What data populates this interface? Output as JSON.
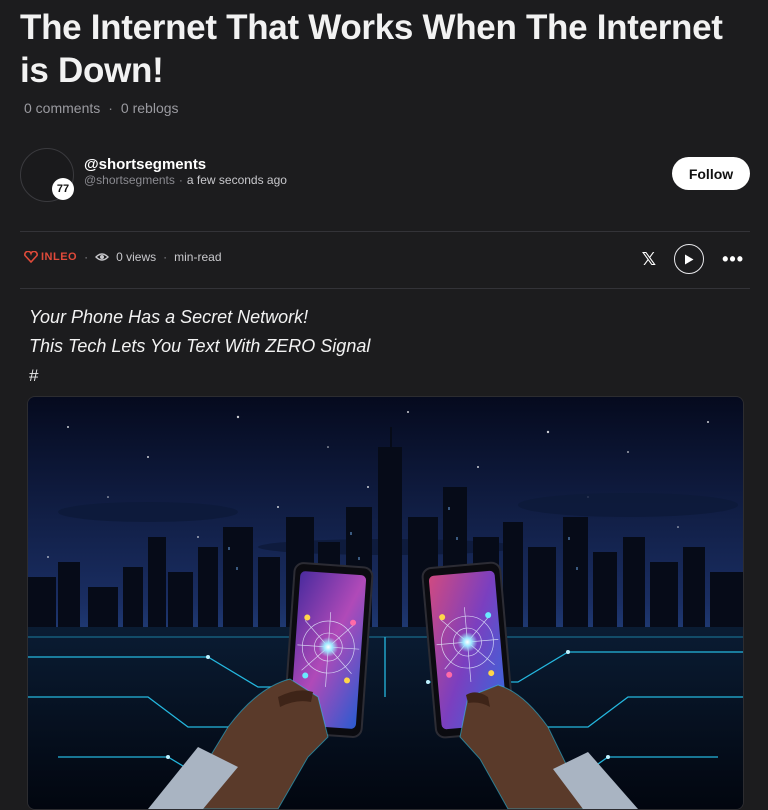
{
  "post": {
    "title": "The Internet That Works When The Internet is Down!",
    "comments": "0 comments",
    "reblogs": "0 reblogs"
  },
  "author": {
    "handle": "@shortsegments",
    "username": "@shortsegments",
    "time_ago": "a few seconds ago",
    "reputation": "77",
    "follow_label": "Follow"
  },
  "toolbar": {
    "source_label": "INLEO",
    "views": "0 views",
    "read_time": "min-read"
  },
  "body": {
    "line1": "Your Phone Has a Secret Network!",
    "line2": "This Tech Lets You Text With ZERO Signal",
    "hash": "#"
  },
  "icons": [
    "inleo-logo-icon",
    "eye-icon",
    "x-share-icon",
    "play-icon",
    "more-icon"
  ],
  "colors": {
    "background": "#1c1c1e",
    "accent": "#e04a3a",
    "button_bg": "#ffffff"
  }
}
